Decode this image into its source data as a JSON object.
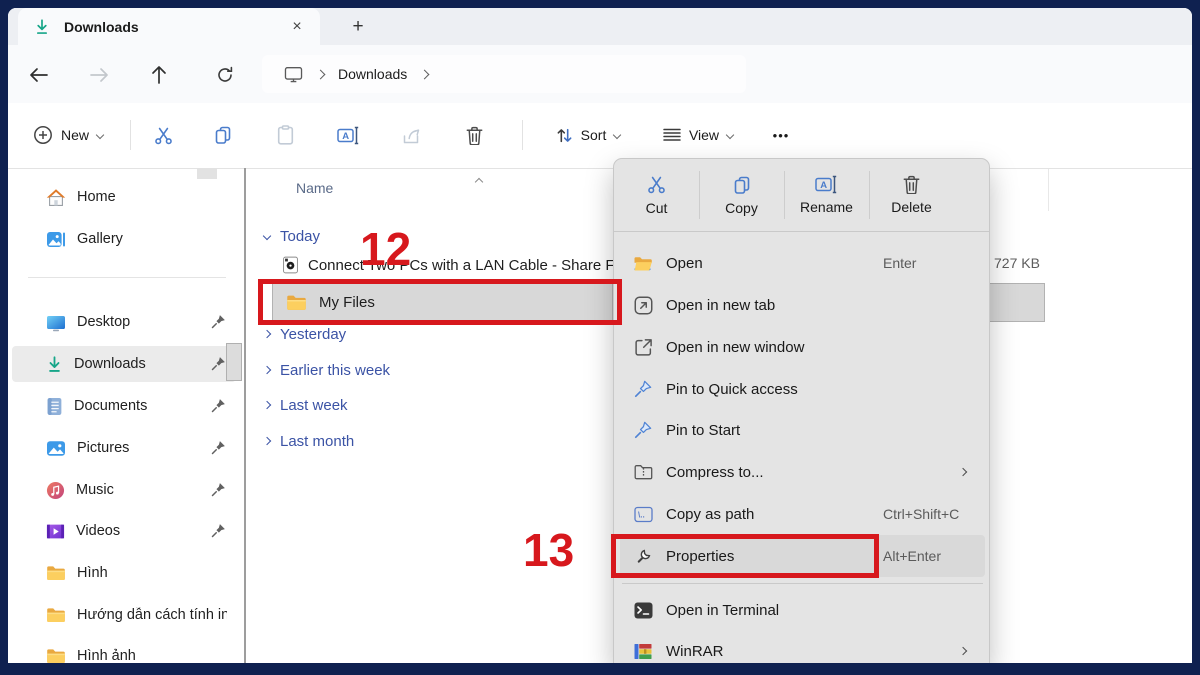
{
  "colors": {
    "window_border": "#0f2150",
    "menu_bg": "#e4e4e4",
    "selection_gray": "#d8d8d8",
    "group_blue": "#3b53a5",
    "annotation_red": "#d7181d",
    "download_teal": "#17a689"
  },
  "tab_bar": {
    "active_tab_title": "Downloads",
    "close_glyph": "×",
    "new_tab_glyph": "+"
  },
  "nav": {
    "breadcrumb_item": "Downloads"
  },
  "toolbar": {
    "new_label": "New",
    "sort_label": "Sort",
    "view_label": "View",
    "more_glyph": "•••"
  },
  "sidebar": {
    "items": [
      {
        "label": "Home",
        "icon": "home",
        "pinned": false
      },
      {
        "label": "Gallery",
        "icon": "gallery",
        "pinned": false
      },
      {
        "label": "Desktop",
        "icon": "desktop",
        "pinned": true
      },
      {
        "label": "Downloads",
        "icon": "download",
        "pinned": true,
        "selected": true
      },
      {
        "label": "Documents",
        "icon": "document",
        "pinned": true
      },
      {
        "label": "Pictures",
        "icon": "pictures",
        "pinned": true
      },
      {
        "label": "Music",
        "icon": "music",
        "pinned": true
      },
      {
        "label": "Videos",
        "icon": "videos",
        "pinned": true
      },
      {
        "label": "Hình",
        "icon": "folder",
        "pinned": false
      },
      {
        "label": "Hướng dẫn cách tính in",
        "icon": "folder",
        "pinned": false
      },
      {
        "label": "Hình ảnh",
        "icon": "folder",
        "pinned": false
      }
    ]
  },
  "file_pane": {
    "column_header": "Name",
    "groups": [
      {
        "label": "Today",
        "expanded": true
      },
      {
        "label": "Yesterday",
        "expanded": false
      },
      {
        "label": "Earlier this week",
        "expanded": false
      },
      {
        "label": "Last week",
        "expanded": false
      },
      {
        "label": "Last month",
        "expanded": false
      }
    ],
    "rows": [
      {
        "name": "Connect Two PCs with a LAN Cable - Share F",
        "size": "727 KB",
        "icon": "media-file"
      },
      {
        "name": "My Files",
        "icon": "folder",
        "selected": true
      }
    ]
  },
  "context_menu": {
    "quick_actions": [
      {
        "label": "Cut"
      },
      {
        "label": "Copy"
      },
      {
        "label": "Rename"
      },
      {
        "label": "Delete"
      }
    ],
    "items": [
      {
        "label": "Open",
        "shortcut": "Enter"
      },
      {
        "label": "Open in new tab"
      },
      {
        "label": "Open in new window"
      },
      {
        "label": "Pin to Quick access"
      },
      {
        "label": "Pin to Start"
      },
      {
        "label": "Compress to...",
        "submenu": true
      },
      {
        "label": "Copy as path",
        "shortcut": "Ctrl+Shift+C"
      },
      {
        "label": "Properties",
        "shortcut": "Alt+Enter",
        "highlighted": true
      },
      {
        "label": "Open in Terminal"
      },
      {
        "label": "WinRAR",
        "submenu": true
      }
    ]
  },
  "annotations": {
    "step_12": "12",
    "step_13": "13"
  }
}
